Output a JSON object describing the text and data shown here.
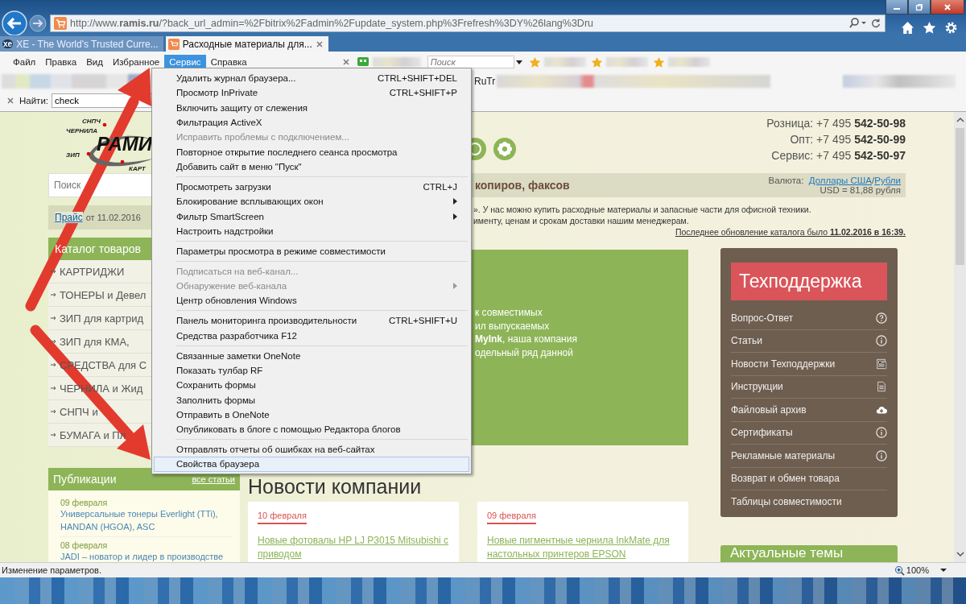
{
  "address_bar": {
    "url": "http://www.**ramis.ru**/?back_url_admin=%2Fbitrix%2Fadmin%2Fupdate_system.php%3Frefresh%3DY%26lang%3Dru"
  },
  "tabs": [
    {
      "label": "XE - The World's Trusted Curre...",
      "icon_text": "xe",
      "selected": false
    },
    {
      "label": "Расходные материалы для...",
      "selected": true
    }
  ],
  "menu_bar": [
    {
      "label": "Файл",
      "selected": false
    },
    {
      "label": "Правка",
      "selected": false
    },
    {
      "label": "Вид",
      "selected": false
    },
    {
      "label": "Избранное",
      "selected": false
    },
    {
      "label": "Сервис",
      "selected": true
    },
    {
      "label": "Справка",
      "selected": false
    }
  ],
  "toolbar_search": {
    "placeholder": "Поиск"
  },
  "favorites_bar": {
    "visible_text": "RuTr"
  },
  "find_bar": {
    "label": "Найти:",
    "value": "check"
  },
  "tools_menu": [
    [
      {
        "label": "Удалить журнал браузера...",
        "shortcut": "CTRL+SHIFT+DEL",
        "disabled": false,
        "submenu": false,
        "selected": false
      },
      {
        "label": "Просмотр InPrivate",
        "shortcut": "CTRL+SHIFT+P",
        "disabled": false,
        "submenu": false,
        "selected": false
      },
      {
        "label": "Включить защиту от слежения",
        "disabled": false,
        "submenu": false,
        "selected": false
      },
      {
        "label": "Фильтрация ActiveX",
        "disabled": false,
        "submenu": false,
        "selected": false
      },
      {
        "label": "Исправить проблемы с подключением...",
        "disabled": true,
        "submenu": false,
        "selected": false
      },
      {
        "label": "Повторное открытие последнего сеанса просмотра",
        "disabled": false,
        "submenu": false,
        "selected": false
      },
      {
        "label": "Добавить сайт в меню \"Пуск\"",
        "disabled": false,
        "submenu": false,
        "selected": false
      }
    ],
    [
      {
        "label": "Просмотреть загрузки",
        "shortcut": "CTRL+J",
        "disabled": false,
        "submenu": false,
        "selected": false
      },
      {
        "label": "Блокирование всплывающих окон",
        "disabled": false,
        "submenu": true,
        "selected": false
      },
      {
        "label": "Фильтр SmartScreen",
        "disabled": false,
        "submenu": true,
        "selected": false
      },
      {
        "label": "Настроить надстройки",
        "disabled": false,
        "submenu": false,
        "selected": false
      }
    ],
    [
      {
        "label": "Параметры просмотра в режиме совместимости",
        "disabled": false,
        "submenu": false,
        "selected": false
      }
    ],
    [
      {
        "label": "Подписаться на веб-канал...",
        "disabled": true,
        "submenu": false,
        "selected": false
      },
      {
        "label": "Обнаружение веб-канала",
        "disabled": true,
        "submenu": true,
        "selected": false
      },
      {
        "label": "Центр обновления Windows",
        "disabled": false,
        "submenu": false,
        "selected": false
      }
    ],
    [
      {
        "label": "Панель мониторинга производительности",
        "shortcut": "CTRL+SHIFT+U",
        "disabled": false,
        "submenu": false,
        "selected": false
      },
      {
        "label": "Средства разработчика F12",
        "disabled": false,
        "submenu": false,
        "selected": false
      }
    ],
    [
      {
        "label": "Связанные заметки OneNote",
        "disabled": false,
        "submenu": false,
        "selected": false
      },
      {
        "label": "Показать тулбар RF",
        "disabled": false,
        "submenu": false,
        "selected": false
      },
      {
        "label": "Сохранить формы",
        "disabled": false,
        "submenu": false,
        "selected": false
      },
      {
        "label": "Заполнить формы",
        "disabled": false,
        "submenu": false,
        "selected": false
      },
      {
        "label": "Отправить в OneNote",
        "disabled": false,
        "submenu": false,
        "selected": false
      },
      {
        "label": "Опубликовать в блоге с помощью Редактора блогов",
        "disabled": false,
        "submenu": false,
        "selected": false
      }
    ],
    [
      {
        "label": "Отправлять отчеты об ошибках на веб-сайтах",
        "disabled": false,
        "submenu": false,
        "selected": false
      },
      {
        "label": "Свойства браузера",
        "disabled": false,
        "submenu": false,
        "selected": true
      }
    ]
  ],
  "site": {
    "logo": {
      "small_labels": [
        "СНПЧ",
        "ЧЕРНИЛА",
        "ЗИП",
        "КАРТ"
      ],
      "name": "РАМИ"
    },
    "phones": [
      {
        "label": "Розница:",
        "prefix": "+7 495",
        "number": "542-50-98"
      },
      {
        "label": "Опт:",
        "prefix": "+7 495",
        "number": "542-50-99"
      },
      {
        "label": "Сервис:",
        "prefix": "+7 495",
        "number": "542-50-97"
      }
    ],
    "search": {
      "placeholder": "Поиск"
    },
    "category_title": "копиров, факсов",
    "currency": {
      "label": "Валюта:",
      "options": [
        "Доллары США",
        "Рубли"
      ],
      "divider": "/",
      "rate": "USD = 81,88 рубля"
    },
    "price_list": {
      "link": "Прайс",
      "date": "от 11.02.2016"
    },
    "intro_lines": [
      "». У нас можно купить расходные материалы и запасные части для офисной техники.",
      "именту, ценам и срокам доставки нашим менеджерам."
    ],
    "update_note": "Последнее обновление каталога было **11.02.2016 в 16:39.**",
    "catalog": {
      "title": "Каталог товаров",
      "items": [
        "КАРТРИДЖИ",
        "ТОНЕРЫ и Девел",
        "ЗИП для картрид",
        "ЗИП для КМА,",
        "СРЕДСТВА для С",
        "ЧЕРНИЛА и Жид",
        "СНПЧ и",
        "БУМАГА и Пл"
      ]
    },
    "banner_lines": [
      "к совместимых",
      "ил выпускаемых",
      "**MyInk**, наша компания",
      "одельный ряд данной"
    ],
    "publications": {
      "title": "Публикации",
      "link": "все статьи",
      "items": [
        {
          "date": "09 февраля",
          "title": "Универсальные тонеры Everlight (TTi), HANDAN (HGOA), ASC"
        },
        {
          "date": "08 февраля",
          "title": "JADI – новатор и лидер в производстве"
        }
      ]
    },
    "news": {
      "title": "Новости компании",
      "items": [
        {
          "date": "10 февраля",
          "title": "Новые фотовалы HP LJ P3015 Mitsubishi с приводом"
        },
        {
          "date": "09 февраля",
          "title": "Новые пигментные чернила InkMate для настольных принтеров EPSON"
        }
      ]
    },
    "support": {
      "title": "Техподдержка",
      "items": [
        {
          "label": "Вопрос-Ответ",
          "kind": "question"
        },
        {
          "label": "Статьи",
          "kind": "info"
        },
        {
          "label": "Новости Техподдержки",
          "kind": "news"
        },
        {
          "label": "Инструкции",
          "kind": "doc"
        },
        {
          "label": "Файловый архив",
          "kind": "cloud"
        },
        {
          "label": "Сертификаты",
          "kind": "info"
        },
        {
          "label": "Рекламные материалы",
          "kind": "info"
        },
        {
          "label": "Возврат и обмен товара",
          "kind": "plain"
        },
        {
          "label": "Таблицы совместимости",
          "kind": "plain"
        }
      ]
    },
    "topics": {
      "title": "Актуальные темы"
    }
  },
  "status_bar": {
    "text": "Изменение параметров.",
    "zoom": "100%"
  }
}
